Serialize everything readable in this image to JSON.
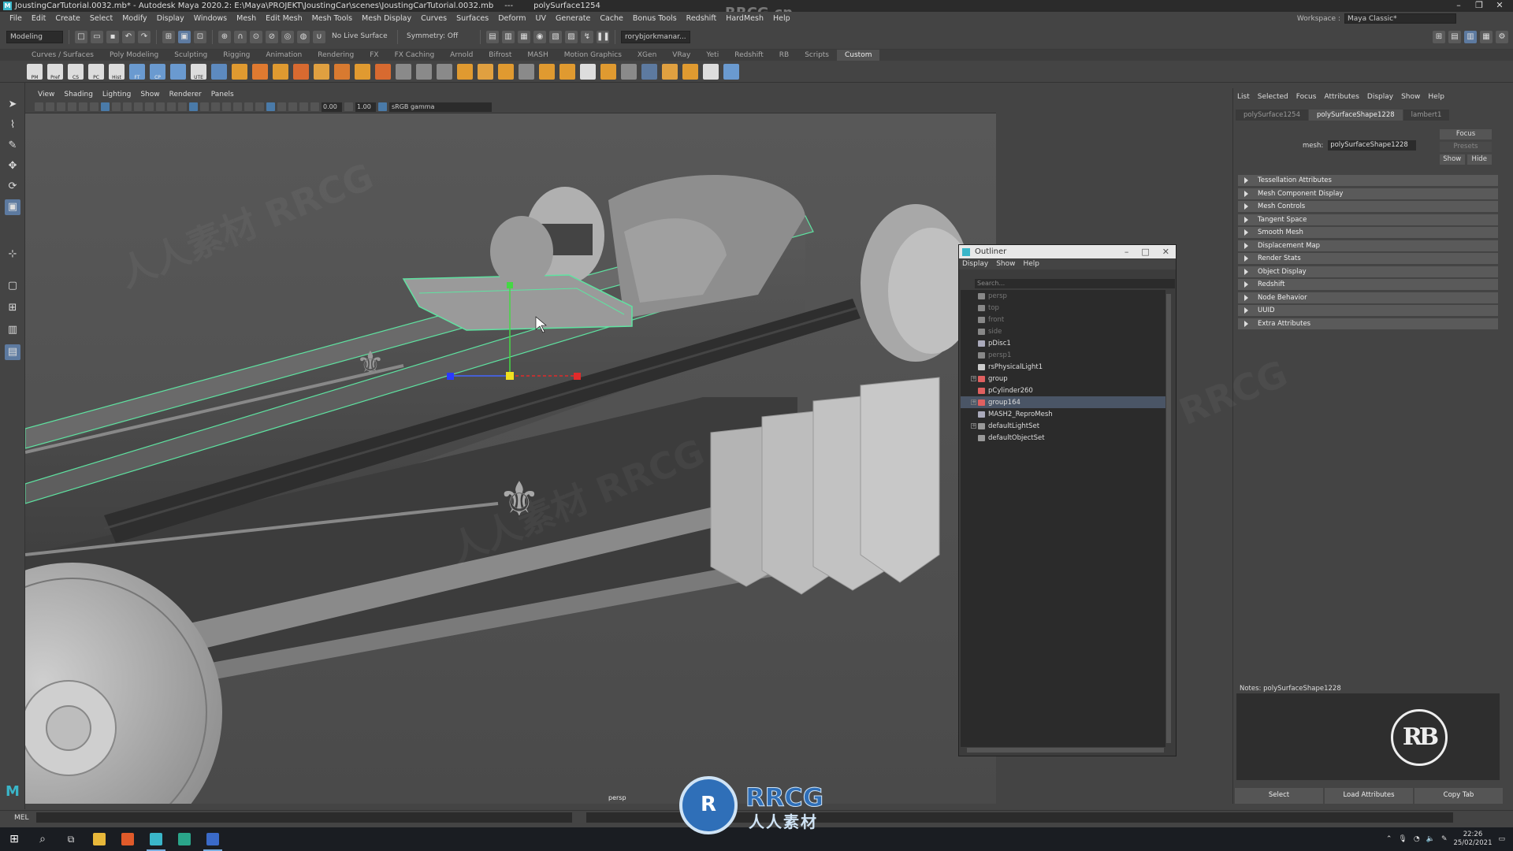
{
  "title": {
    "file": "JoustingCarTutorial.0032.mb* - Autodesk Maya 2020.2: E:\\Maya\\PROJEKT\\JoustingCar\\scenes\\JoustingCarTutorial.0032.mb",
    "separator": "---",
    "object": "polySurface1254",
    "watermark": "RRCG.cn",
    "workspace_label": "Workspace :",
    "workspace_value": "Maya Classic*"
  },
  "menus": [
    "File",
    "Edit",
    "Create",
    "Select",
    "Modify",
    "Display",
    "Windows",
    "Mesh",
    "Edit Mesh",
    "Mesh Tools",
    "Mesh Display",
    "Curves",
    "Surfaces",
    "Deform",
    "UV",
    "Generate",
    "Cache",
    "Bonus Tools",
    "Redshift",
    "HardMesh",
    "Help"
  ],
  "statusline": {
    "mode": "Modeling",
    "live_surface": "No Live Surface",
    "symmetry": "Symmetry: Off",
    "user": "rorybjorkmanar..."
  },
  "shelf_tabs": [
    "Curves / Surfaces",
    "Poly Modeling",
    "Sculpting",
    "Rigging",
    "Animation",
    "Rendering",
    "FX",
    "FX Caching",
    "Arnold",
    "Bifrost",
    "MASH",
    "Motion Graphics",
    "XGen",
    "VRay",
    "Yeti",
    "Redshift",
    "RB",
    "Scripts",
    "Custom"
  ],
  "shelf_active": "Custom",
  "shelf_labels": [
    "PM",
    "Pref",
    "CS",
    "PC",
    "Hist",
    "FT",
    "CP",
    "",
    "UTE"
  ],
  "viewport": {
    "menus": [
      "View",
      "Shading",
      "Lighting",
      "Show",
      "Renderer",
      "Panels"
    ],
    "exposure": "0.00",
    "gamma": "1.00",
    "colorspace": "sRGB gamma",
    "camera": "persp"
  },
  "outliner": {
    "title": "Outliner",
    "menus": [
      "Display",
      "Show",
      "Help"
    ],
    "search_placeholder": "Search...",
    "items": [
      {
        "label": "persp",
        "dim": true,
        "expand": false,
        "selected": false,
        "color": "#888"
      },
      {
        "label": "top",
        "dim": true,
        "expand": false,
        "selected": false,
        "color": "#888"
      },
      {
        "label": "front",
        "dim": true,
        "expand": false,
        "selected": false,
        "color": "#888"
      },
      {
        "label": "side",
        "dim": true,
        "expand": false,
        "selected": false,
        "color": "#888"
      },
      {
        "label": "pDisc1",
        "dim": false,
        "expand": false,
        "selected": false,
        "color": "#aab"
      },
      {
        "label": "persp1",
        "dim": true,
        "expand": false,
        "selected": false,
        "color": "#888"
      },
      {
        "label": "rsPhysicalLight1",
        "dim": false,
        "expand": false,
        "selected": false,
        "color": "#ccc"
      },
      {
        "label": "group",
        "dim": false,
        "expand": true,
        "selected": false,
        "color": "#e06060"
      },
      {
        "label": "pCylinder260",
        "dim": false,
        "expand": false,
        "selected": false,
        "color": "#e06060"
      },
      {
        "label": "group164",
        "dim": false,
        "expand": true,
        "selected": true,
        "color": "#e06060"
      },
      {
        "label": "MASH2_ReproMesh",
        "dim": false,
        "expand": false,
        "selected": false,
        "color": "#aab"
      },
      {
        "label": "defaultLightSet",
        "dim": false,
        "expand": true,
        "selected": false,
        "color": "#999"
      },
      {
        "label": "defaultObjectSet",
        "dim": false,
        "expand": false,
        "selected": false,
        "color": "#999"
      }
    ]
  },
  "attribute_editor": {
    "menus": [
      "List",
      "Selected",
      "Focus",
      "Attributes",
      "Display",
      "Show",
      "Help"
    ],
    "tabs": [
      "polySurface1254",
      "polySurfaceShape1228",
      "lambert1"
    ],
    "active_tab": "polySurfaceShape1228",
    "mesh_label": "mesh:",
    "mesh_value": "polySurfaceShape1228",
    "focus_btn": "Focus",
    "presets_btn": "Presets",
    "show_btn": "Show",
    "hide_btn": "Hide",
    "sections": [
      "Tessellation Attributes",
      "Mesh Component Display",
      "Mesh Controls",
      "Tangent Space",
      "Smooth Mesh",
      "Displacement Map",
      "Render Stats",
      "Object Display",
      "Redshift",
      "Node Behavior",
      "UUID",
      "Extra Attributes"
    ],
    "notes_label": "Notes:  polySurfaceShape1228",
    "logo_text": "RB",
    "bottom_buttons": [
      "Select",
      "Load Attributes",
      "Copy Tab"
    ]
  },
  "cmdline": {
    "label": "MEL"
  },
  "taskbar": {
    "time": "22:26",
    "date": "25/02/2021"
  },
  "overlay": {
    "logo_glyph": "R",
    "name": "RRCG",
    "subtitle": "人人素材"
  },
  "colors": {
    "selection_green": "#5fe3a1",
    "panel": "#444444",
    "dark_field": "#2b2b2b",
    "accent_blue": "#2f6fb8"
  }
}
